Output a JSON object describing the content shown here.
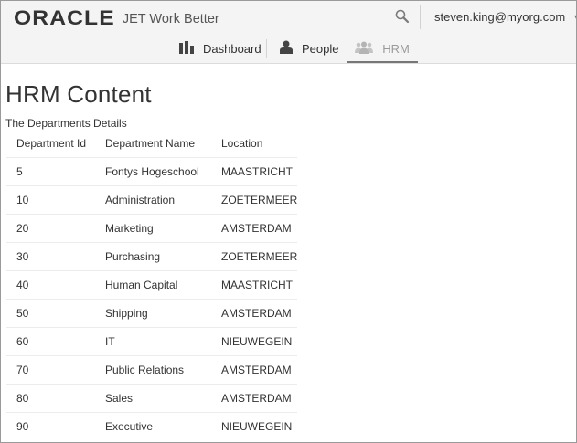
{
  "header": {
    "logo_text": "ORACLE",
    "app_name": "JET Work Better",
    "user": "steven.king@myorg.com"
  },
  "nav": {
    "tabs": [
      {
        "label": "Dashboard",
        "icon": "bar-chart-icon"
      },
      {
        "label": "People",
        "icon": "person-icon"
      },
      {
        "label": "HRM",
        "icon": "group-icon",
        "selected": true
      }
    ]
  },
  "main": {
    "title": "HRM Content",
    "subtitle": "The Departments Details",
    "columns": [
      "Department Id",
      "Department Name",
      "Location"
    ],
    "rows": [
      [
        "5",
        "Fontys Hogeschool",
        "MAASTRICHT"
      ],
      [
        "10",
        "Administration",
        "ZOETERMEER"
      ],
      [
        "20",
        "Marketing",
        "AMSTERDAM"
      ],
      [
        "30",
        "Purchasing",
        "ZOETERMEER"
      ],
      [
        "40",
        "Human Capital",
        "MAASTRICHT"
      ],
      [
        "50",
        "Shipping",
        "AMSTERDAM"
      ],
      [
        "60",
        "IT",
        "NIEUWEGEIN"
      ],
      [
        "70",
        "Public Relations",
        "AMSTERDAM"
      ],
      [
        "80",
        "Sales",
        "AMSTERDAM"
      ],
      [
        "90",
        "Executive",
        "NIEUWEGEIN"
      ]
    ]
  },
  "colors": {
    "header_bg": "#f4f4f4",
    "selected_tab_text": "#9a9a9a",
    "text": "#333333"
  }
}
